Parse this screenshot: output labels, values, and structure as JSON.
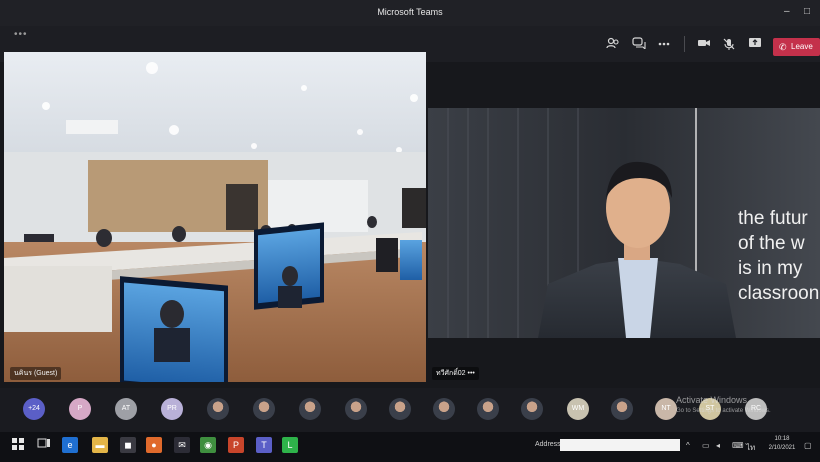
{
  "window": {
    "title": "Microsoft Teams",
    "minimize": "–",
    "maximize": "□"
  },
  "toolbar": {
    "more_dots": "•••",
    "leave_label": "Leave"
  },
  "tiles": {
    "left_label": "นคินร (Guest)",
    "right_label": "ทวีศักดิ์02 •••",
    "screen_text": [
      "the futur",
      "of the w",
      "is in my",
      "classroon"
    ]
  },
  "participants": [
    {
      "initials": "+24",
      "color": "#5b5fc7"
    },
    {
      "initials": "P",
      "color": "#d6a8c6"
    },
    {
      "initials": "AT",
      "color": "#9ea0a6"
    },
    {
      "initials": "PR",
      "color": "#b9b1d8"
    },
    {
      "initials": "",
      "color": "photo"
    },
    {
      "initials": "",
      "color": "photo"
    },
    {
      "initials": "",
      "color": "photo"
    },
    {
      "initials": "",
      "color": "photo"
    },
    {
      "initials": "",
      "color": "photo"
    },
    {
      "initials": "",
      "color": "photo"
    },
    {
      "initials": "",
      "color": "photo"
    },
    {
      "initials": "",
      "color": "photo"
    },
    {
      "initials": "WM",
      "color": "#c8c2b0"
    },
    {
      "initials": "",
      "color": "photo"
    },
    {
      "initials": "NT",
      "color": "#c9b7a8"
    },
    {
      "initials": "ST",
      "color": "#d0c6a0"
    },
    {
      "initials": "RC",
      "color": "#bdbdbd"
    }
  ],
  "watermark": {
    "line1": "Activate Windows",
    "line2": "Go to Settings to activate Windows."
  },
  "taskbar": {
    "address_label": "Address",
    "address_value": "",
    "clock_time": "10:18",
    "clock_date": "2/10/2021"
  }
}
